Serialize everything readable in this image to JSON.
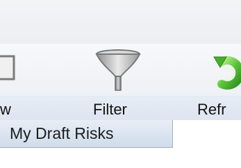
{
  "toolbar": {
    "items": [
      {
        "label": "w",
        "icon": "view-icon"
      },
      {
        "label": "Filter",
        "icon": "funnel-icon"
      },
      {
        "label": "Refr",
        "icon": "refresh-icon"
      }
    ]
  },
  "tabs": [
    {
      "label": "My Draft Risks",
      "selected": true
    }
  ]
}
